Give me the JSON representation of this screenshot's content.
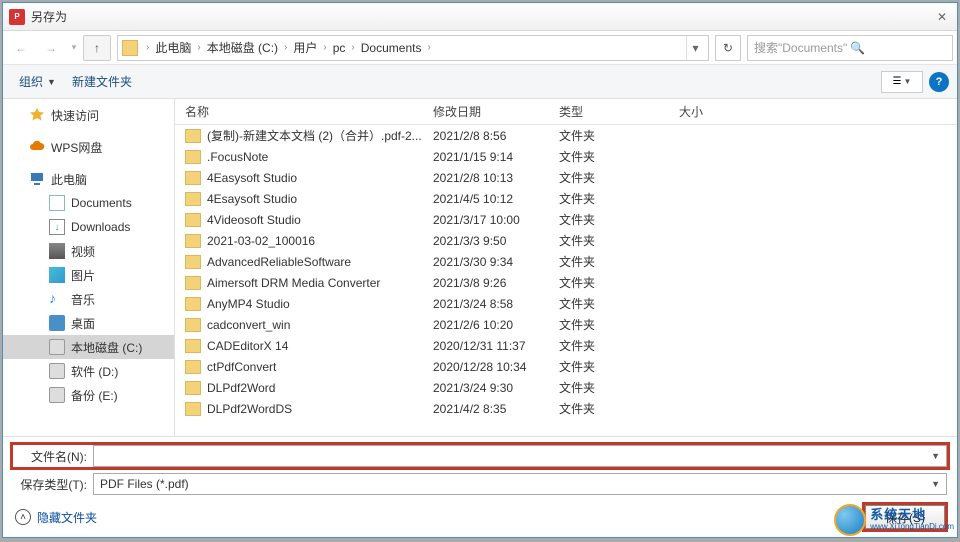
{
  "title": "另存为",
  "breadcrumb": [
    "此电脑",
    "本地磁盘 (C:)",
    "用户",
    "pc",
    "Documents"
  ],
  "search_placeholder": "搜索\"Documents\"",
  "toolbar": {
    "organize": "组织",
    "new_folder": "新建文件夹"
  },
  "sidebar": {
    "quick": "快速访问",
    "wps": "WPS网盘",
    "thispc": "此电脑",
    "items": [
      {
        "label": "Documents"
      },
      {
        "label": "Downloads"
      },
      {
        "label": "视频"
      },
      {
        "label": "图片"
      },
      {
        "label": "音乐"
      },
      {
        "label": "桌面"
      },
      {
        "label": "本地磁盘 (C:)"
      },
      {
        "label": "软件 (D:)"
      },
      {
        "label": "备份 (E:)"
      }
    ]
  },
  "columns": {
    "name": "名称",
    "date": "修改日期",
    "type": "类型",
    "size": "大小"
  },
  "files": [
    {
      "name": "(复制)-新建文本文档 (2)（合并）.pdf-2...",
      "date": "2021/2/8 8:56",
      "type": "文件夹"
    },
    {
      "name": ".FocusNote",
      "date": "2021/1/15 9:14",
      "type": "文件夹"
    },
    {
      "name": "4Easysoft Studio",
      "date": "2021/2/8 10:13",
      "type": "文件夹"
    },
    {
      "name": "4Esaysoft Studio",
      "date": "2021/4/5 10:12",
      "type": "文件夹"
    },
    {
      "name": "4Videosoft Studio",
      "date": "2021/3/17 10:00",
      "type": "文件夹"
    },
    {
      "name": "2021-03-02_100016",
      "date": "2021/3/3 9:50",
      "type": "文件夹"
    },
    {
      "name": "AdvancedReliableSoftware",
      "date": "2021/3/30 9:34",
      "type": "文件夹"
    },
    {
      "name": "Aimersoft DRM Media Converter",
      "date": "2021/3/8 9:26",
      "type": "文件夹"
    },
    {
      "name": "AnyMP4 Studio",
      "date": "2021/3/24 8:58",
      "type": "文件夹"
    },
    {
      "name": "cadconvert_win",
      "date": "2021/2/6 10:20",
      "type": "文件夹"
    },
    {
      "name": "CADEditorX 14",
      "date": "2020/12/31 11:37",
      "type": "文件夹"
    },
    {
      "name": "ctPdfConvert",
      "date": "2020/12/28 10:34",
      "type": "文件夹"
    },
    {
      "name": "DLPdf2Word",
      "date": "2021/3/24 9:30",
      "type": "文件夹"
    },
    {
      "name": "DLPdf2WordDS",
      "date": "2021/4/2 8:35",
      "type": "文件夹"
    }
  ],
  "form": {
    "filename_label": "文件名(N):",
    "filename_value": "",
    "type_label": "保存类型(T):",
    "type_value": "PDF Files (*.pdf)"
  },
  "footer": {
    "hide_folders": "隐藏文件夹",
    "save": "保存(S)"
  },
  "watermark": {
    "cn": "系统天地",
    "en": "www.XiTongTianDi.com"
  }
}
